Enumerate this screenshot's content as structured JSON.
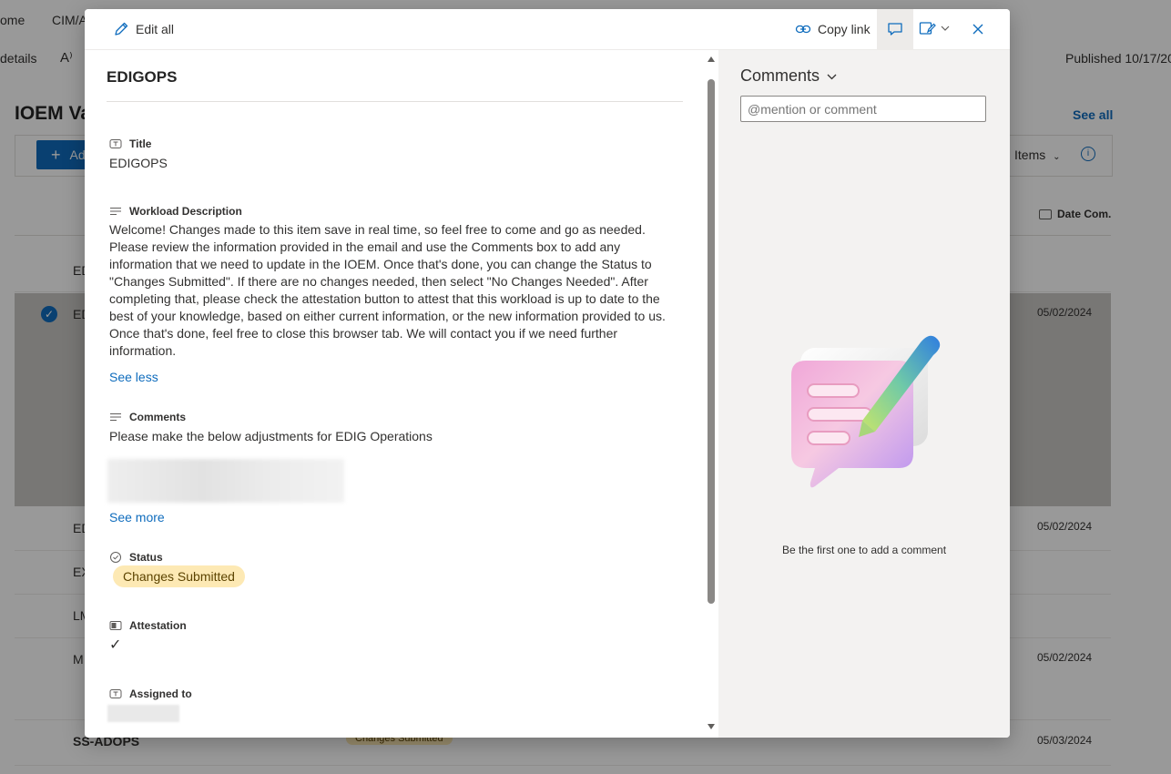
{
  "background": {
    "nav": [
      "ome",
      "CIM/A"
    ],
    "details": "details",
    "font_icon": "A⁾",
    "published": "Published 10/17/20",
    "list_title": "IOEM Va",
    "see_all": "See all",
    "add_label": "Ad",
    "items_label": "Items",
    "date_col": "Date Com.",
    "rows": [
      {
        "name": "ED",
        "date": ""
      },
      {
        "name": "ED",
        "date": "05/02/2024"
      },
      {
        "name": "ED",
        "date": "05/02/2024"
      },
      {
        "name": "EX",
        "date": ""
      },
      {
        "name": "LM",
        "date": ""
      },
      {
        "name": "M",
        "date": "05/02/2024"
      },
      {
        "name": "SS-ADOPS",
        "date": "05/03/2024",
        "status": "Changes Submitted"
      }
    ]
  },
  "toolbar": {
    "edit_all": "Edit all",
    "copy_link": "Copy link"
  },
  "item": {
    "heading": "EDIGOPS",
    "fields": {
      "title_label": "Title",
      "title_value": "EDIGOPS",
      "workload_label": "Workload Description",
      "workload_value": "Welcome! Changes made to this item save in real time, so feel free to come and go as needed. Please review the information provided in the email and use the Comments box to add any information that we need to update in the IOEM. Once that's done, you can change the Status to \"Changes Submitted\". If there are no changes needed, then select \"No Changes Needed\". After completing that, please check the attestation button to attest that this workload is up to date to the best of your knowledge, based on either current information, or the new information provided to us. Once that's done, feel free to close this browser tab. We will contact you if we need further information.",
      "see_less": "See less",
      "comments_label": "Comments",
      "comments_value": "Please make the below adjustments for EDIG Operations",
      "see_more": "See more",
      "status_label": "Status",
      "status_value": "Changes Submitted",
      "attestation_label": "Attestation",
      "attestation_value": "✓",
      "assigned_label": "Assigned to"
    }
  },
  "comments_pane": {
    "header": "Comments",
    "placeholder": "@mention or comment",
    "empty_text": "Be the first one to add a comment"
  },
  "colors": {
    "accent": "#0f6cbd",
    "status_pill_bg": "#fde9b4",
    "pane_bg": "#f3f2f1"
  }
}
